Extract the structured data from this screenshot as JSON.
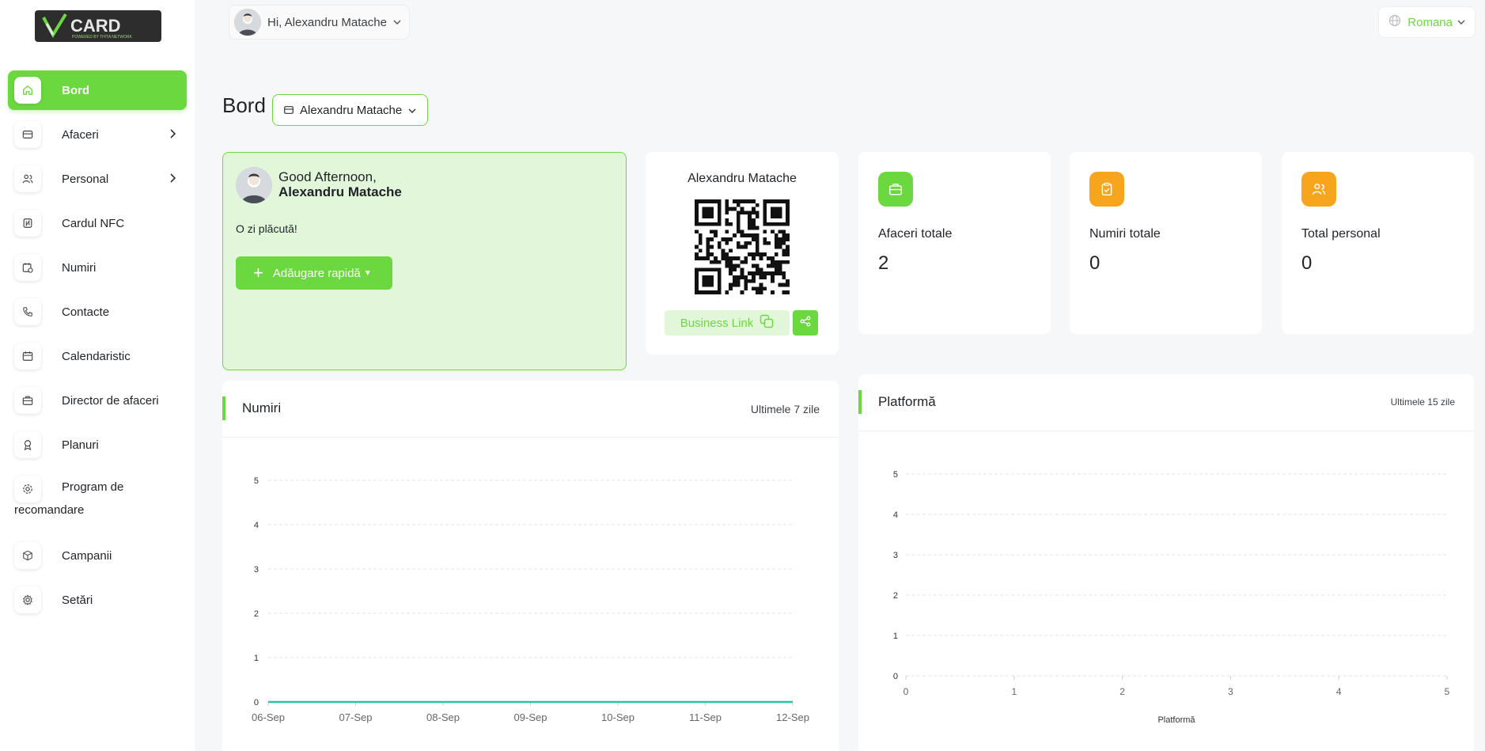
{
  "brand": {
    "logo_text": "CARD",
    "logo_tagline": "POWERED BY TH!TA NETWORK",
    "logo_icon": "vcard-logo"
  },
  "sidebar": {
    "items": [
      {
        "label": "Bord",
        "icon": "home-icon",
        "active": true
      },
      {
        "label": "Afaceri",
        "icon": "card-icon",
        "has_children": true
      },
      {
        "label": "Personal",
        "icon": "users-icon",
        "has_children": true
      },
      {
        "label": "Cardul NFC",
        "icon": "nfc-icon"
      },
      {
        "label": "Numiri",
        "icon": "calendar-clock-icon"
      },
      {
        "label": "Contacte",
        "icon": "phone-icon"
      },
      {
        "label": "Calendaristic",
        "icon": "calendar-icon"
      },
      {
        "label": "Director de afaceri",
        "icon": "briefcase-icon"
      },
      {
        "label": "Planuri",
        "icon": "award-icon"
      },
      {
        "label_line1": "Program de",
        "label_line2": "recomandare",
        "icon": "gear-icon"
      },
      {
        "label": "Campanii",
        "icon": "box-icon"
      },
      {
        "label": "Setări",
        "icon": "settings-icon"
      }
    ]
  },
  "topbar": {
    "user_greeting": "Hi, Alexandru Matache",
    "language": "Romana"
  },
  "page": {
    "title": "Bord",
    "business_select": "Alexandru Matache"
  },
  "greeting_card": {
    "line1": "Good Afternoon,",
    "line2": "Alexandru Matache",
    "message": "O zi plăcută!",
    "quick_add_label": "Adăugare rapidă"
  },
  "qr_card": {
    "name": "Alexandru Matache",
    "business_link_label": "Business Link"
  },
  "stats": [
    {
      "label": "Afaceri totale",
      "value": "2",
      "icon": "briefcase-icon",
      "color": "#6bd83f"
    },
    {
      "label": "Numiri totale",
      "value": "0",
      "icon": "clipboard-check-icon",
      "color": "#f7a51c"
    },
    {
      "label": "Total personal",
      "value": "0",
      "icon": "users-icon",
      "color": "#f7a51c"
    }
  ],
  "appointments_chart": {
    "title": "Numiri",
    "range_label": "Ultimele 7 zile"
  },
  "platform_chart": {
    "title": "Platformă",
    "range_label": "Ultimele 15 zile"
  },
  "colors": {
    "accent": "#6bd83f",
    "orange": "#f7a51c",
    "line": "#26c6a0"
  },
  "chart_data": [
    {
      "type": "line",
      "title": "Numiri",
      "categories": [
        "06-Sep",
        "07-Sep",
        "08-Sep",
        "09-Sep",
        "10-Sep",
        "11-Sep",
        "12-Sep"
      ],
      "series": [
        {
          "values": [
            0,
            0,
            0,
            0,
            0,
            0,
            0
          ]
        }
      ],
      "ylim": [
        0,
        5
      ],
      "yticks": [
        "0",
        "1",
        "2",
        "3",
        "4",
        "5"
      ],
      "grid": true
    },
    {
      "type": "line",
      "title": "Platformă",
      "x": [
        "0",
        "1",
        "2",
        "3",
        "4",
        "5"
      ],
      "series": [],
      "ylim": [
        0,
        5
      ],
      "yticks": [
        "0",
        "1",
        "2",
        "3",
        "4",
        "5"
      ],
      "xlabel": "Platformă",
      "grid": true
    }
  ]
}
